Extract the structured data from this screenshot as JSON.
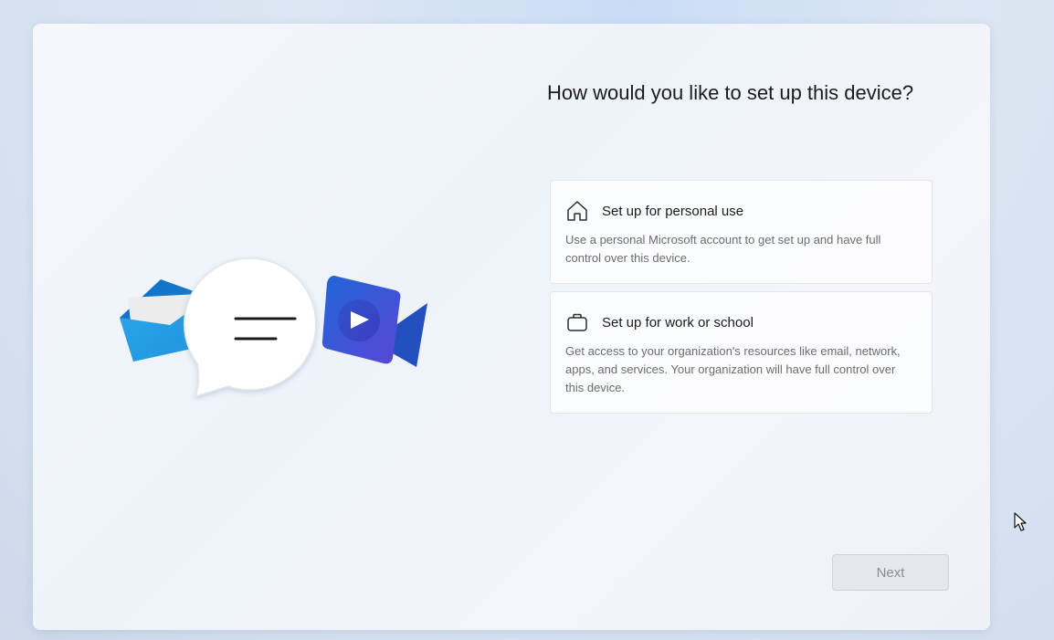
{
  "setup": {
    "question": "How would you like to set up this device?",
    "options": [
      {
        "title": "Set up for personal use",
        "description": "Use a personal Microsoft account to get set up and have full control over this device.",
        "icon": "home-icon"
      },
      {
        "title": "Set up for work or school",
        "description": "Get access to your organization's resources like email, network, apps, and services. Your organization will have full control over this device.",
        "icon": "briefcase-icon"
      }
    ],
    "next_label": "Next"
  },
  "illustration": {
    "icons": [
      "mail-icon",
      "chat-bubble-icon",
      "video-camera-icon"
    ]
  },
  "colors": {
    "mail": "#1e90d6",
    "video": "#4b4fd8",
    "button_bg": "#e4e7ec",
    "button_text": "#8a8d92"
  }
}
